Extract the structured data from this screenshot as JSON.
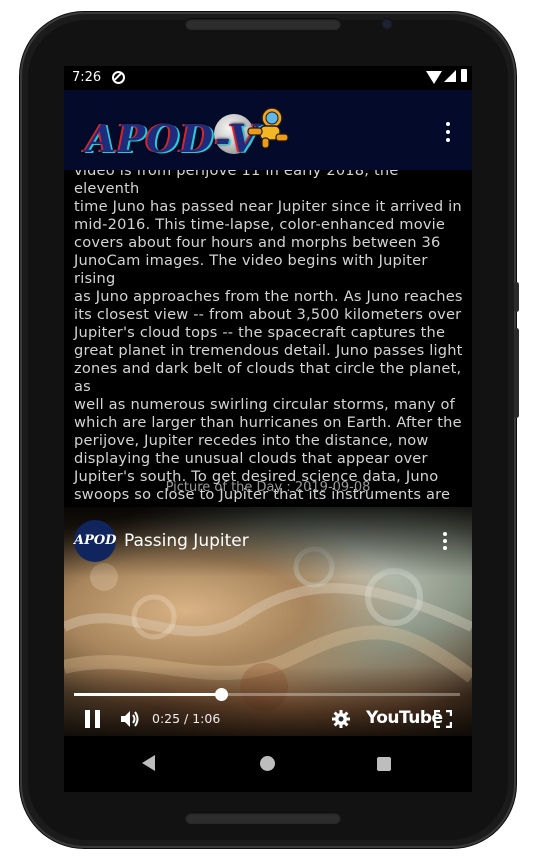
{
  "status_bar": {
    "time": "7:26",
    "icons": [
      "app-notification-icon",
      "wifi-icon",
      "signal-icon",
      "battery-icon"
    ]
  },
  "app_bar": {
    "logo_text": "APOD-V",
    "menu_icon": "overflow-menu-icon"
  },
  "content": {
    "explanation": "video is from perijove 11 in early 2018, the eleventh\ntime Juno has passed near Jupiter since it arrived in\nmid-2016.  This time-lapse, color-enhanced movie\ncovers about four hours and morphs between 36\nJunoCam images. The video begins with Jupiter rising\nas Juno approaches from the north. As Juno reaches\nits closest view -- from about 3,500 kilometers over\nJupiter's cloud tops -- the spacecraft captures the\ngreat planet in tremendous detail. Juno passes light\nzones and dark belt of clouds that circle the planet, as\nwell as numerous swirling circular storms, many of\nwhich are larger than hurricanes on Earth.  After the\nperijove, Jupiter recedes into the distance, now\ndisplaying the unusual clouds that appear over\nJupiter's south.  To get desired science data, Juno\nswoops so close to Jupiter that its instruments are\nexposed to very high levels of radiation.",
    "date_label": "Picture of the Day : 2019-09-08"
  },
  "video": {
    "channel_avatar_text": "APOD",
    "title": "Passing Jupiter",
    "current_time": "0:25 / 1:06",
    "progress_fraction": 0.38,
    "platform_label": "YouTube",
    "icons": [
      "pause-icon",
      "volume-icon",
      "gear-icon",
      "fullscreen-icon",
      "more-vert-icon"
    ]
  },
  "navigation": {
    "icons": [
      "back-icon",
      "home-icon",
      "recents-icon"
    ]
  },
  "colors": {
    "app_bar_background": "#030a2a",
    "screen_background": "#000000",
    "body_text": "#d4d4d4",
    "date_text": "#9a9a9a"
  }
}
